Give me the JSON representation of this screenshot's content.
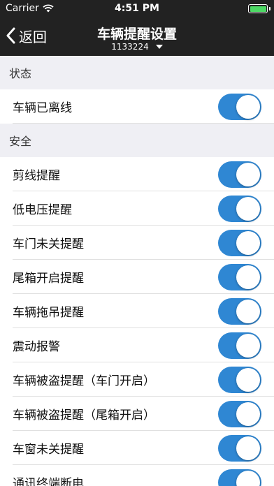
{
  "status_bar": {
    "carrier": "Carrier",
    "time": "4:51 PM"
  },
  "nav": {
    "back_label": "返回",
    "title": "车辆提醒设置",
    "vehicle_id": "1133224"
  },
  "colors": {
    "nav_background": "#222222",
    "toggle_on": "#2f87d3",
    "battery": "#4cd964"
  },
  "sections": [
    {
      "header": "状态",
      "items": [
        {
          "label": "车辆已离线",
          "on": true
        }
      ]
    },
    {
      "header": "安全",
      "items": [
        {
          "label": "剪线提醒",
          "on": true
        },
        {
          "label": "低电压提醒",
          "on": true
        },
        {
          "label": "车门未关提醒",
          "on": true
        },
        {
          "label": "尾箱开启提醒",
          "on": true
        },
        {
          "label": "车辆拖吊提醒",
          "on": true
        },
        {
          "label": "震动报警",
          "on": true
        },
        {
          "label": "车辆被盗提醒（车门开启）",
          "on": true
        },
        {
          "label": "车辆被盗提醒（尾箱开启）",
          "on": true
        },
        {
          "label": "车窗未关提醒",
          "on": true
        },
        {
          "label": "通讯终端断电",
          "on": true
        }
      ]
    }
  ]
}
